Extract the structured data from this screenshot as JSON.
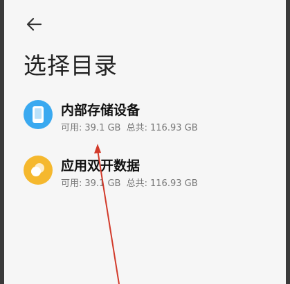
{
  "header": {
    "back_icon": "arrow-left-icon",
    "title": "选择目录"
  },
  "directories": [
    {
      "name": "内部存储设备",
      "icon": "phone-icon",
      "icon_color": "#3aa9f0",
      "available_label": "可用:",
      "available_value": "39.1 GB",
      "total_label": "总共:",
      "total_value": "116.93 GB"
    },
    {
      "name": "应用双开数据",
      "icon": "dual-app-icon",
      "icon_color": "#f5b82e",
      "available_label": "可用:",
      "available_value": "39.1 GB",
      "total_label": "总共:",
      "total_value": "116.93 GB"
    }
  ],
  "colors": {
    "annotation_arrow": "#d23a2a",
    "background": "#f6f6f6"
  }
}
